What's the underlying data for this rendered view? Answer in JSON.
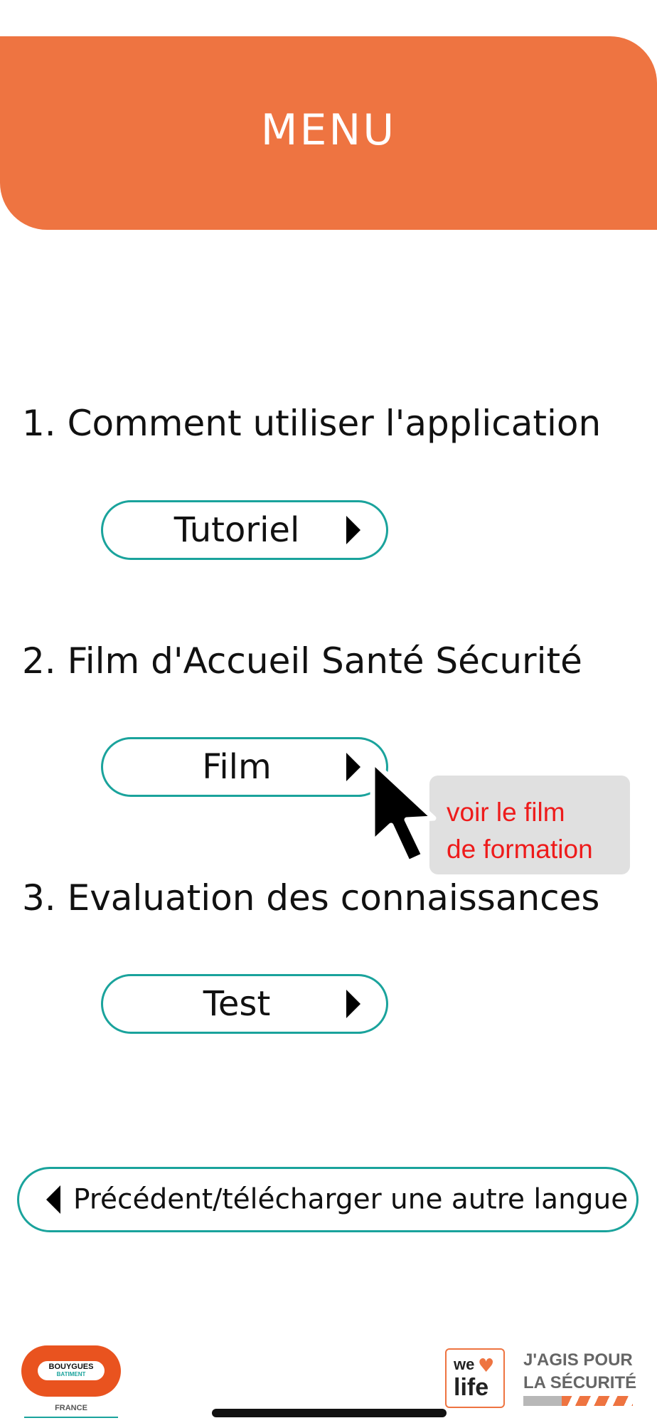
{
  "header": {
    "title": "MENU",
    "color": "#EE7441"
  },
  "sections": [
    {
      "title": "1. Comment utiliser l'application",
      "button_label": "Tutoriel",
      "button_icon": "play-icon"
    },
    {
      "title": "2. Film d'Accueil Santé Sécurité",
      "button_label": "Film",
      "button_icon": "play-icon"
    },
    {
      "title": "3. Evaluation des connaissances",
      "button_label": "Test",
      "button_icon": "play-icon"
    }
  ],
  "tooltip": {
    "line1": "voir le film",
    "line2": "de formation",
    "text_color": "#EE1B1B",
    "icon": "cursor-arrow-icon"
  },
  "back_button": {
    "label": "Précédent/télécharger une autre langue",
    "icon": "back-icon"
  },
  "footer": {
    "bouygues": {
      "name": "BOUYGUES",
      "sub": "BATIMENT",
      "country": "FRANCE"
    },
    "welife": {
      "we": "we",
      "life": "life"
    },
    "agis_line1": "J'AGIS POUR",
    "agis_line2": "LA SÉCURITÉ"
  },
  "colors": {
    "accent": "#1AA39C",
    "brand": "#EE7441"
  }
}
